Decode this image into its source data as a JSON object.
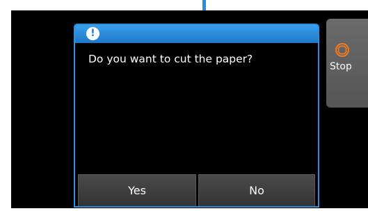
{
  "dialog": {
    "icon": "alert-icon",
    "icon_glyph": "!",
    "message": "Do you want to cut the paper?",
    "buttons": {
      "yes_label": "Yes",
      "no_label": "No"
    }
  },
  "side_panel": {
    "stop_label": "Stop",
    "stop_icon": "stop-icon"
  },
  "colors": {
    "dialog_accent": "#2b8fe0",
    "stop_icon": "#f07a1e",
    "button_bg": "#3f3f3f",
    "screen_bg": "#000000"
  }
}
